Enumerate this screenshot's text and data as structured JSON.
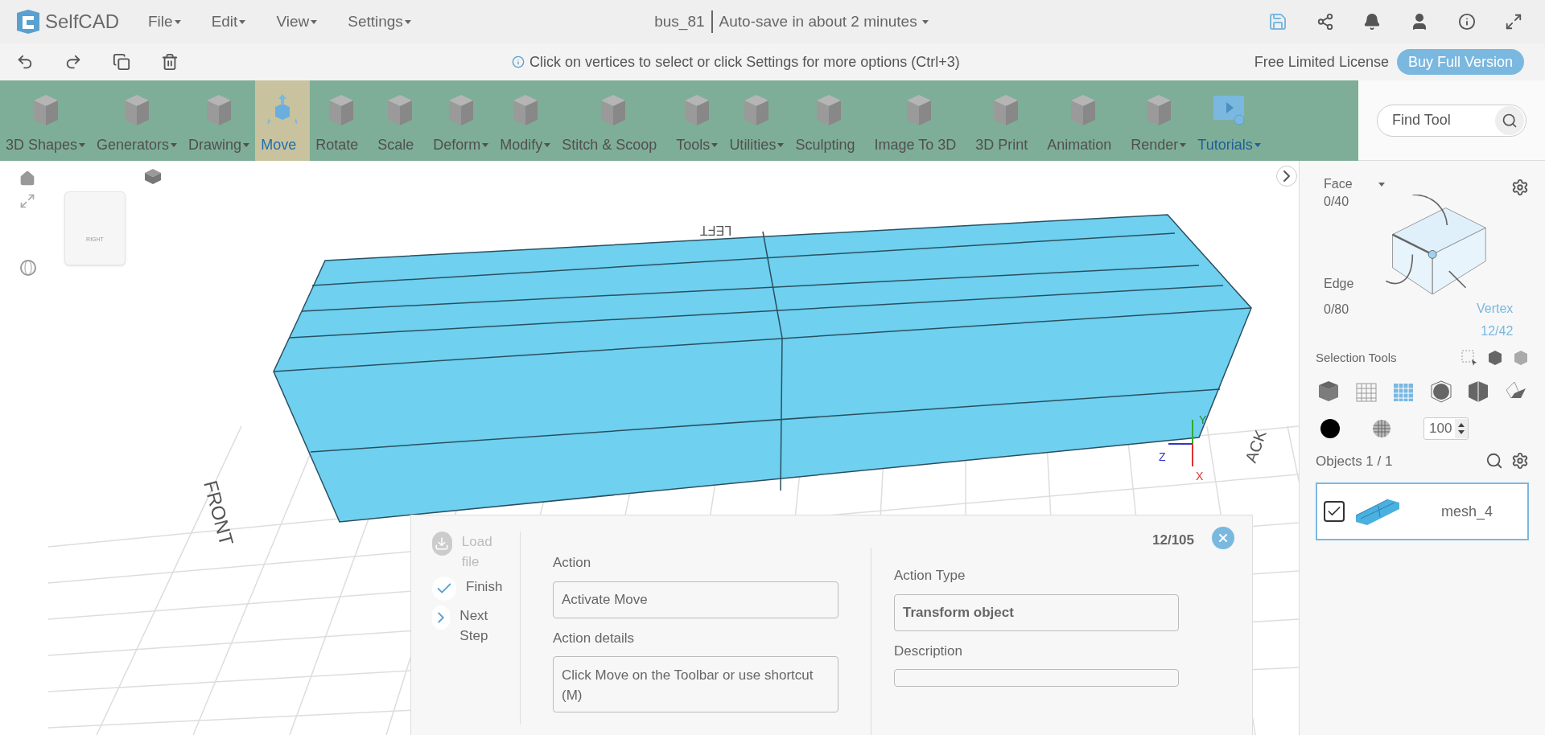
{
  "app": {
    "logo_text": "SelfCAD",
    "menus": [
      {
        "label": "File"
      },
      {
        "label": "Edit"
      },
      {
        "label": "View"
      },
      {
        "label": "Settings"
      }
    ],
    "project_name": "bus_81",
    "autosave": "Auto-save in about 2 minutes"
  },
  "hint": "Click on vertices to select or click Settings for more options (Ctrl+3)",
  "license": "Free Limited License",
  "buy_button": "Buy Full Version",
  "toolbar": [
    {
      "label": "3D Shapes",
      "dropdown": true,
      "selected": false,
      "kind": "tool"
    },
    {
      "label": "Generators",
      "dropdown": true,
      "selected": false,
      "kind": "tool"
    },
    {
      "label": "Drawing",
      "dropdown": true,
      "selected": false,
      "kind": "tool"
    },
    {
      "label": "Move",
      "dropdown": false,
      "selected": true,
      "kind": "tool"
    },
    {
      "label": "Rotate",
      "dropdown": false,
      "selected": false,
      "kind": "tool"
    },
    {
      "label": "Scale",
      "dropdown": false,
      "selected": false,
      "kind": "tool"
    },
    {
      "label": "Deform",
      "dropdown": true,
      "selected": false,
      "kind": "tool"
    },
    {
      "label": "Modify",
      "dropdown": true,
      "selected": false,
      "kind": "tool"
    },
    {
      "label": "Stitch & Scoop",
      "dropdown": false,
      "selected": false,
      "kind": "tool"
    },
    {
      "label": "Tools",
      "dropdown": true,
      "selected": false,
      "kind": "tool"
    },
    {
      "label": "Utilities",
      "dropdown": true,
      "selected": false,
      "kind": "tool"
    },
    {
      "label": "Sculpting",
      "dropdown": false,
      "selected": false,
      "kind": "tool"
    },
    {
      "label": "Image To 3D",
      "dropdown": false,
      "selected": false,
      "kind": "tool"
    },
    {
      "label": "3D Print",
      "dropdown": false,
      "selected": false,
      "kind": "tool"
    },
    {
      "label": "Animation",
      "dropdown": false,
      "selected": false,
      "kind": "tool"
    },
    {
      "label": "Render",
      "dropdown": true,
      "selected": false,
      "kind": "tool"
    },
    {
      "label": "Tutorials",
      "dropdown": true,
      "selected": false,
      "kind": "link"
    }
  ],
  "find_tool": {
    "placeholder": "Find Tool"
  },
  "viewport": {
    "cube_label": "RIGHT",
    "grid_labels": [
      "LEFT",
      "FRONT",
      "ACK"
    ],
    "axes": [
      "Y",
      "Z",
      "X"
    ]
  },
  "selection": {
    "modes": [
      {
        "label": "Face",
        "count": "0/40",
        "selected": false
      },
      {
        "label": "Edge",
        "count": "0/80",
        "selected": false
      },
      {
        "label": "Vertex",
        "count": "12/42",
        "selected": true
      }
    ],
    "tools_label": "Selection Tools",
    "styles": [
      {
        "selected": false
      },
      {
        "selected": false
      },
      {
        "selected": true
      },
      {
        "selected": false
      },
      {
        "selected": false
      },
      {
        "selected": false
      }
    ],
    "color": "#000000",
    "opacity": "100"
  },
  "objects": {
    "title": "Objects 1 / 1",
    "items": [
      {
        "name": "mesh_4",
        "checked": true,
        "selected": true
      }
    ]
  },
  "tutorial": {
    "steps": [
      {
        "label": "Load file",
        "kind": "load",
        "disabled": true
      },
      {
        "label": "Finish",
        "kind": "finish",
        "disabled": false
      },
      {
        "label": "Next Step",
        "kind": "next",
        "disabled": false
      }
    ],
    "counter": "12/105",
    "action_label": "Action",
    "action": "Activate Move",
    "details_label": "Action details",
    "details": "Click Move on the Toolbar or use shortcut (M)",
    "type_label": "Action Type",
    "type": "Transform object",
    "description_label": "Description"
  }
}
